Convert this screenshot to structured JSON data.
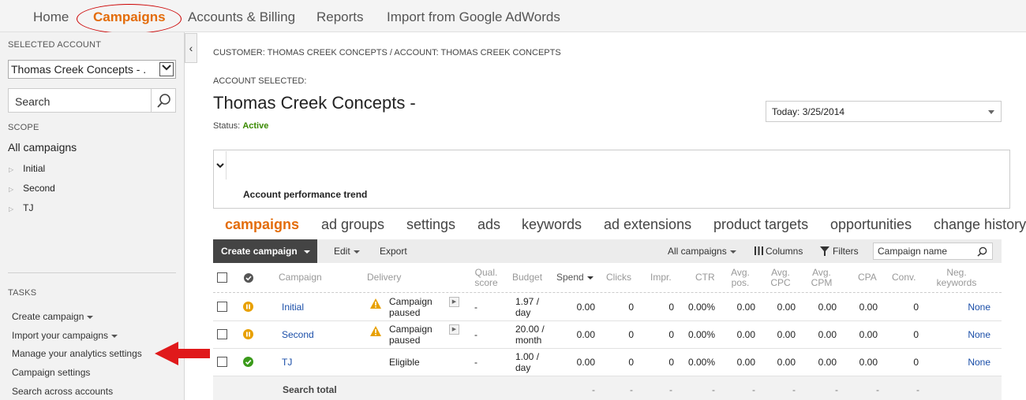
{
  "topnav": {
    "items": [
      "Home",
      "Campaigns",
      "Accounts & Billing",
      "Reports",
      "Import from Google AdWords"
    ]
  },
  "sidebar": {
    "selected_account_label": "SELECTED ACCOUNT",
    "account_value": "Thomas Creek Concepts - .",
    "search_placeholder": "Search",
    "scope_label": "SCOPE",
    "scope_all": "All campaigns",
    "tree": [
      "Initial",
      "Second",
      "TJ"
    ],
    "tasks_label": "TASKS",
    "tasks": [
      "Create campaign",
      "Import your campaigns",
      "Manage your analytics settings",
      "Campaign settings",
      "Search across accounts"
    ]
  },
  "main": {
    "breadcrumb": "CUSTOMER: THOMAS CREEK CONCEPTS / ACCOUNT: THOMAS CREEK CONCEPTS",
    "account_selected_label": "ACCOUNT SELECTED:",
    "account_name": "Thomas Creek Concepts -",
    "status_label": "Status:",
    "status_value": "Active",
    "date_range": "Today: 3/25/2014",
    "perf_title": "Account performance trend",
    "tabs": [
      "campaigns",
      "ad groups",
      "settings",
      "ads",
      "keywords",
      "ad extensions",
      "product targets",
      "opportunities",
      "change history"
    ]
  },
  "toolbar": {
    "create": "Create campaign",
    "edit": "Edit",
    "export": "Export",
    "scope": "All campaigns",
    "columns": "Columns",
    "filters": "Filters",
    "name_filter": "Campaign name"
  },
  "table": {
    "headers": {
      "campaign": "Campaign",
      "delivery": "Delivery",
      "qual1": "Qual.",
      "qual2": "score",
      "budget": "Budget",
      "spend": "Spend",
      "clicks": "Clicks",
      "impr": "Impr.",
      "ctr": "CTR",
      "pos1": "Avg.",
      "pos2": "pos.",
      "cpc1": "Avg.",
      "cpc2": "CPC",
      "cpm1": "Avg.",
      "cpm2": "CPM",
      "cpa": "CPA",
      "conv": "Conv.",
      "neg1": "Neg.",
      "neg2": "keywords"
    },
    "rows": [
      {
        "name": "Initial",
        "status_color": "#e8a000",
        "warn": true,
        "delivery1": "Campaign",
        "delivery2": "paused",
        "qual": "-",
        "budget1": "1.97 /",
        "budget2": "day",
        "spend": "0.00",
        "clicks": "0",
        "impr": "0",
        "ctr": "0.00%",
        "pos": "0.00",
        "cpc": "0.00",
        "cpm": "0.00",
        "cpa": "0.00",
        "conv": "0",
        "neg": "None"
      },
      {
        "name": "Second",
        "status_color": "#e8a000",
        "warn": true,
        "delivery1": "Campaign",
        "delivery2": "paused",
        "qual": "-",
        "budget1": "20.00 /",
        "budget2": "month",
        "spend": "0.00",
        "clicks": "0",
        "impr": "0",
        "ctr": "0.00%",
        "pos": "0.00",
        "cpc": "0.00",
        "cpm": "0.00",
        "cpa": "0.00",
        "conv": "0",
        "neg": "None"
      },
      {
        "name": "TJ",
        "status_color": "#3a9a1a",
        "warn": false,
        "delivery1": "Eligible",
        "delivery2": "",
        "qual": "-",
        "budget1": "1.00 /",
        "budget2": "day",
        "spend": "0.00",
        "clicks": "0",
        "impr": "0",
        "ctr": "0.00%",
        "pos": "0.00",
        "cpc": "0.00",
        "cpm": "0.00",
        "cpa": "0.00",
        "conv": "0",
        "neg": "None"
      }
    ],
    "total_label": "Search total",
    "total_dash": "-"
  },
  "colors": {
    "accent": "#e36c0a",
    "link": "#1a4ea8",
    "active_status": "#3a8a00",
    "annotation_red": "#e0191b"
  }
}
